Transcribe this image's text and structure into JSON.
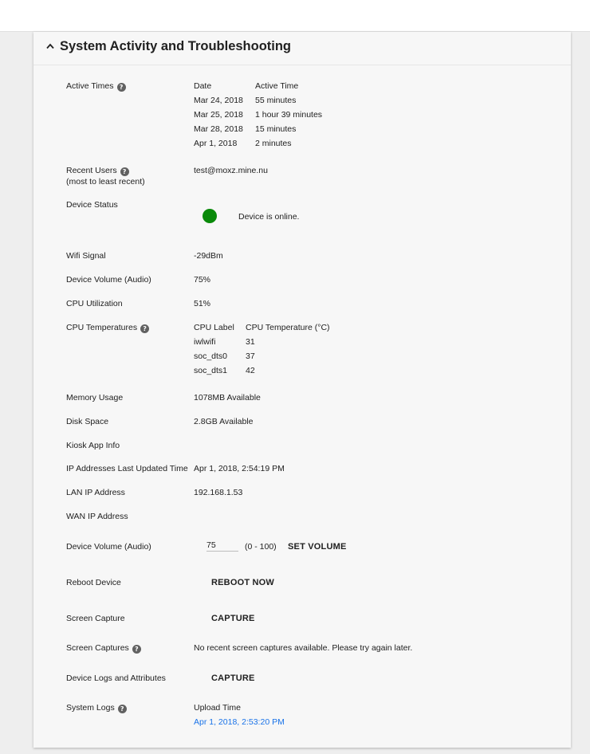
{
  "section": {
    "title": "System Activity and Troubleshooting"
  },
  "active_times": {
    "label": "Active Times",
    "col_date": "Date",
    "col_time": "Active Time",
    "rows": [
      {
        "date": "Mar 24, 2018",
        "time": "55 minutes"
      },
      {
        "date": "Mar 25, 2018",
        "time": "1 hour 39 minutes"
      },
      {
        "date": "Mar 28, 2018",
        "time": "15 minutes"
      },
      {
        "date": "Apr 1, 2018",
        "time": "2 minutes"
      }
    ]
  },
  "recent_users": {
    "label": "Recent Users",
    "sublabel": "(most to least recent)",
    "value": "test@moxz.mine.nu"
  },
  "device_status": {
    "label": "Device Status",
    "value": "Device is online.",
    "color": "#0a8a0a"
  },
  "wifi": {
    "label": "Wifi Signal",
    "value": "-29dBm"
  },
  "volume": {
    "label": "Device Volume (Audio)",
    "value": "75%"
  },
  "cpu_util": {
    "label": "CPU Utilization",
    "value": "51%"
  },
  "cpu_temps": {
    "label": "CPU Temperatures",
    "col_label": "CPU Label",
    "col_temp": "CPU Temperature (°C)",
    "rows": [
      {
        "name": "iwlwifi",
        "temp": "31"
      },
      {
        "name": "soc_dts0",
        "temp": "37"
      },
      {
        "name": "soc_dts1",
        "temp": "42"
      }
    ]
  },
  "memory": {
    "label": "Memory Usage",
    "value": "1078MB Available"
  },
  "disk": {
    "label": "Disk Space",
    "value": "2.8GB Available"
  },
  "kiosk": {
    "label": "Kiosk App Info"
  },
  "ip_updated": {
    "label": "IP Addresses Last Updated Time",
    "value": "Apr 1, 2018, 2:54:19 PM"
  },
  "lan_ip": {
    "label": "LAN IP Address",
    "value": "192.168.1.53"
  },
  "wan_ip": {
    "label": "WAN IP Address"
  },
  "set_volume": {
    "label": "Device Volume (Audio)",
    "input_value": "75",
    "range": "(0 - 100)",
    "button": "SET VOLUME"
  },
  "reboot": {
    "label": "Reboot Device",
    "button": "REBOOT NOW"
  },
  "screen_capture": {
    "label": "Screen Capture",
    "button": "CAPTURE"
  },
  "screen_captures": {
    "label": "Screen Captures",
    "value": "No recent screen captures available. Please try again later."
  },
  "device_logs": {
    "label": "Device Logs and Attributes",
    "button": "CAPTURE"
  },
  "system_logs": {
    "label": "System Logs",
    "col_upload": "Upload Time",
    "link": "Apr 1, 2018, 2:53:20 PM"
  },
  "icons": {
    "help": "help-circle-icon",
    "collapse": "chevron-up-icon",
    "status": "status-dot-icon"
  },
  "colors": {
    "link": "#1a73e8",
    "online": "#0a8a0a"
  }
}
